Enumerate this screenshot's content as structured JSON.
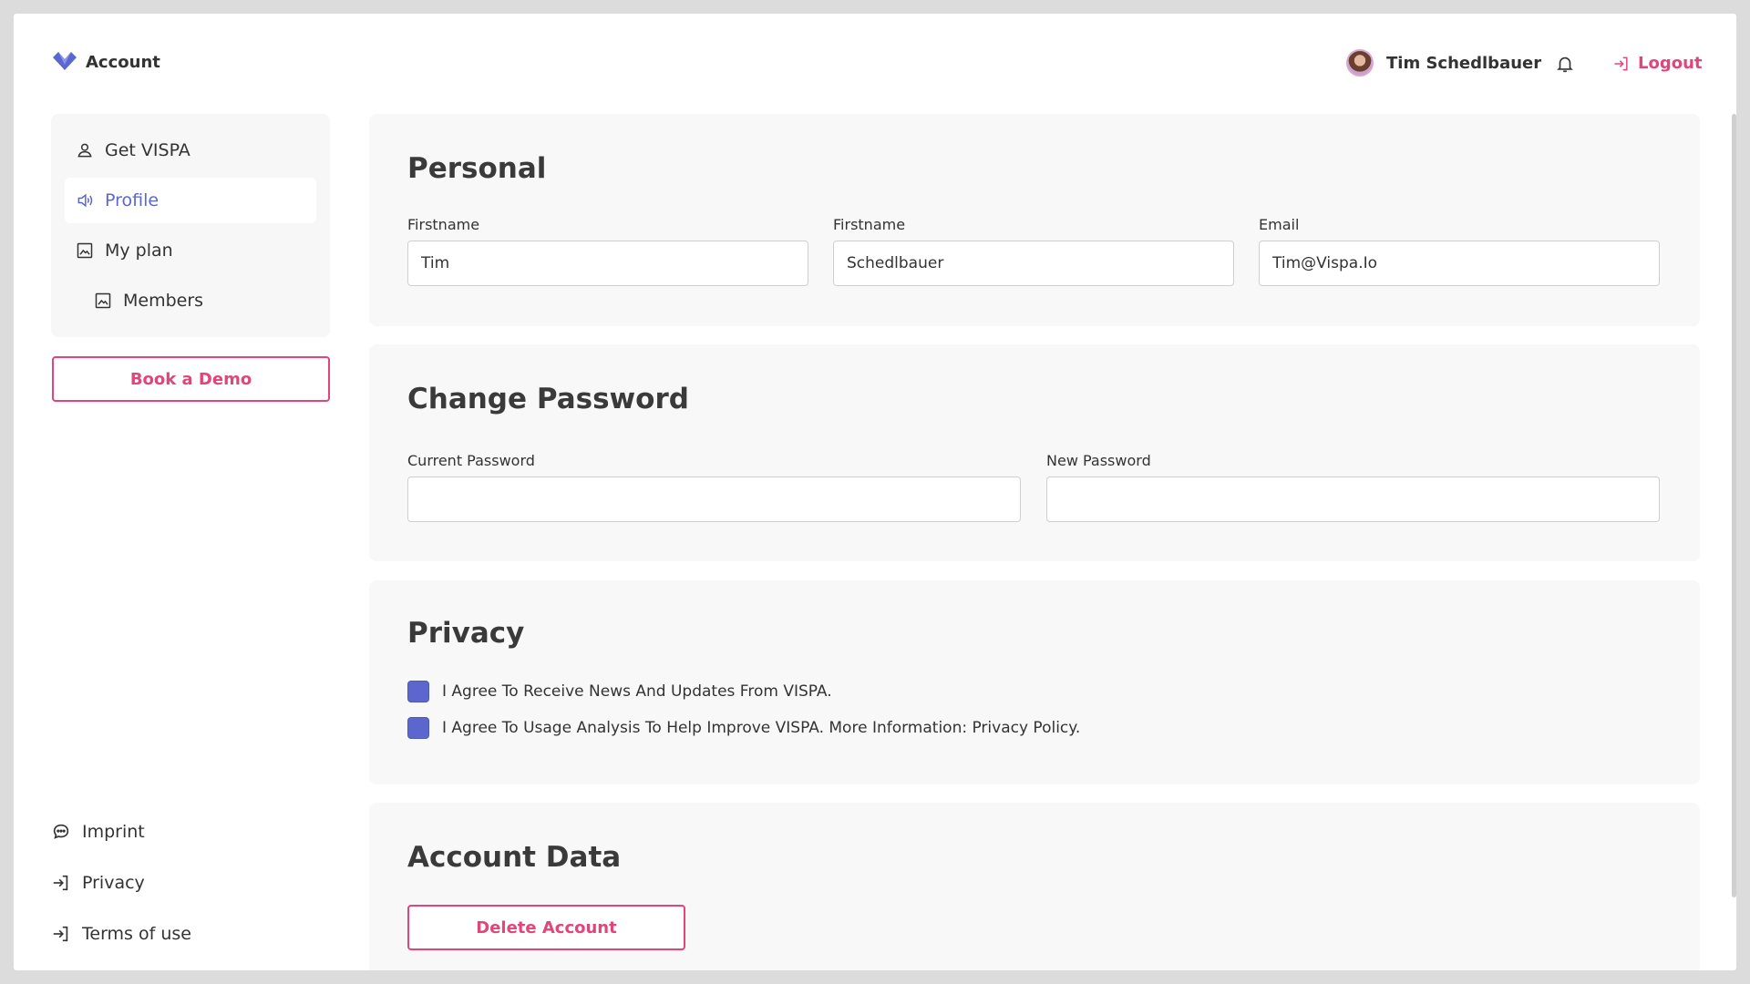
{
  "header": {
    "brand_title": "Account",
    "user_name": "Tim Schedlbauer",
    "logout_label": "Logout"
  },
  "sidebar": {
    "items": [
      {
        "label": "Get VISPA",
        "icon": "user-icon"
      },
      {
        "label": "Profile",
        "icon": "speaker-icon",
        "active": true
      },
      {
        "label": "My plan",
        "icon": "image-icon"
      },
      {
        "label": "Members",
        "icon": "image-icon"
      }
    ],
    "demo_button": "Book a Demo",
    "footer_links": [
      {
        "label": "Imprint",
        "icon": "chat-icon"
      },
      {
        "label": "Privacy",
        "icon": "login-arrow-icon"
      },
      {
        "label": "Terms of use",
        "icon": "login-arrow-icon"
      }
    ]
  },
  "personal": {
    "title": "Personal",
    "firstname_label": "Firstname",
    "firstname_value": "Tim",
    "lastname_label": "Firstname",
    "lastname_value": "Schedlbauer",
    "email_label": "Email",
    "email_value": "Tim@Vispa.Io"
  },
  "password": {
    "title": "Change Password",
    "current_label": "Current Password",
    "current_value": "",
    "new_label": "New Password",
    "new_value": ""
  },
  "privacy": {
    "title": "Privacy",
    "news_label": "I Agree To Receive News And Updates From VISPA.",
    "usage_label": "I Agree To Usage Analysis To Help Improve VISPA. More Information: Privacy Policy."
  },
  "account_data": {
    "title": "Account Data",
    "delete_button": "Delete Account"
  },
  "colors": {
    "accent_pink": "#e1457a",
    "accent_blue": "#5b67cf"
  }
}
